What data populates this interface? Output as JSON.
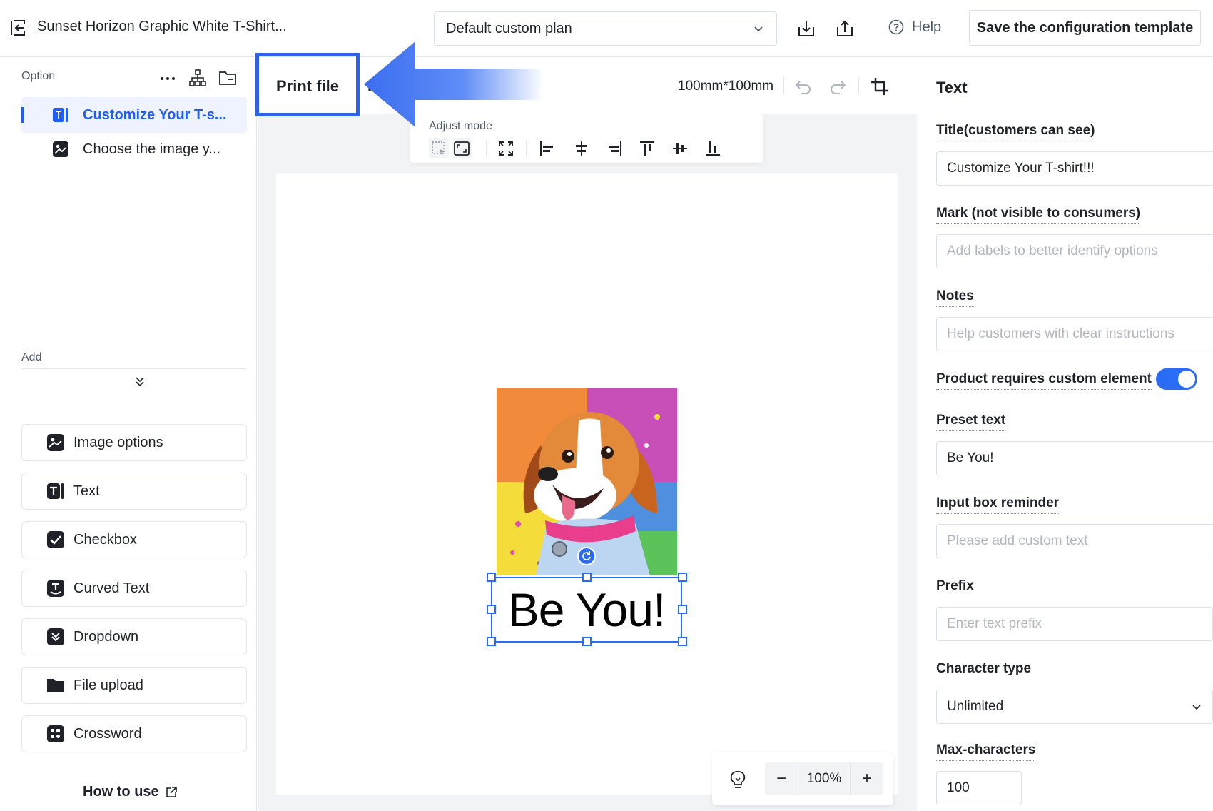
{
  "header": {
    "product_title": "Sunset Horizon Graphic White T-Shirt...",
    "plan_select_value": "Default custom plan",
    "help_label": "Help",
    "save_button_label": "Save the configuration template"
  },
  "left_panel": {
    "option_label": "Option",
    "options": [
      {
        "label": "Customize Your T-s...",
        "icon": "text-icon",
        "active": true
      },
      {
        "label": "Choose the image y...",
        "icon": "image-icon",
        "active": false
      }
    ],
    "add_label": "Add",
    "add_items": [
      {
        "label": "Image options",
        "icon": "image-icon"
      },
      {
        "label": "Text",
        "icon": "text-icon"
      },
      {
        "label": "Checkbox",
        "icon": "checkbox-icon"
      },
      {
        "label": "Curved Text",
        "icon": "curved-text-icon"
      },
      {
        "label": "Dropdown",
        "icon": "dropdown-icon"
      },
      {
        "label": "File upload",
        "icon": "folder-icon"
      },
      {
        "label": "Crossword",
        "icon": "crossword-icon"
      }
    ],
    "how_to_use": "How to use"
  },
  "canvas": {
    "tab_print_file": "Print file",
    "tab_second_partial": "F",
    "size_label": "100mm*100mm",
    "adjust_mode_label": "Adjust mode",
    "text_content": "Be You!",
    "zoom_value": "100%"
  },
  "right_panel": {
    "title": "Text",
    "fields": {
      "title_label": "Title(customers can see)",
      "title_value": "Customize Your T-shirt!!!",
      "mark_label": "Mark (not visible to consumers)",
      "mark_placeholder": "Add labels to better identify options",
      "notes_label": "Notes",
      "notes_placeholder": "Help customers with clear instructions",
      "requires_label": "Product requires custom element",
      "requires_on": true,
      "preset_label": "Preset text",
      "preset_value": "Be You!",
      "reminder_label": "Input box reminder",
      "reminder_placeholder": "Please add custom text",
      "prefix_label": "Prefix",
      "prefix_placeholder": "Enter text prefix",
      "char_type_label": "Character type",
      "char_type_value": "Unlimited",
      "max_chars_label": "Max-characters",
      "max_chars_value": "100"
    }
  },
  "colors": {
    "accent": "#1f5ef0",
    "highlight": "#2e62e8",
    "selection": "#2b6cf5"
  }
}
